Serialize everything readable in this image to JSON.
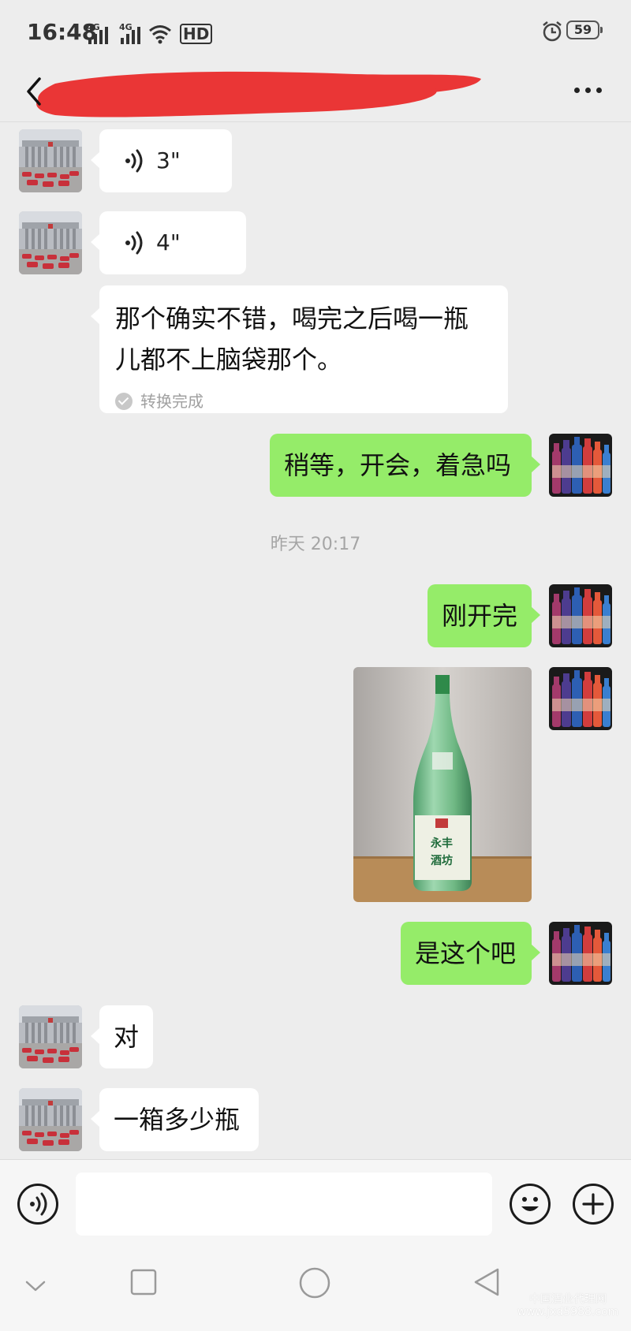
{
  "status_bar": {
    "time": "16:48",
    "network_1": "4G",
    "network_2": "4G",
    "hd_label": "HD",
    "battery_level": "59"
  },
  "header": {
    "back_icon": "chevron-left-icon",
    "title_redacted": true,
    "more_icon": "more-dots-icon"
  },
  "messages": [
    {
      "side": "incoming",
      "type": "voice",
      "duration": "3\""
    },
    {
      "side": "incoming",
      "type": "voice",
      "duration": "4\""
    },
    {
      "side": "incoming",
      "type": "voice-transcript",
      "text_line_1": "那个确实不错，喝完之后喝一瓶",
      "text_line_2": "儿都不上脑袋那个。",
      "status": "转换完成"
    },
    {
      "side": "outgoing",
      "type": "text",
      "text": "稍等，开会，着急吗"
    },
    {
      "type": "timestamp",
      "text": "昨天 20:17"
    },
    {
      "side": "outgoing",
      "type": "text",
      "text": "刚开完"
    },
    {
      "side": "outgoing",
      "type": "image",
      "label_text": "永丰酒坊"
    },
    {
      "side": "outgoing",
      "type": "text",
      "text": "是这个吧"
    },
    {
      "side": "incoming",
      "type": "text",
      "text": "对"
    },
    {
      "side": "incoming",
      "type": "text",
      "text": "一箱多少瓶"
    }
  ],
  "input_bar": {
    "voice_icon": "voice-input-icon",
    "text_value": "",
    "emoji_icon": "emoji-icon",
    "plus_icon": "plus-icon"
  },
  "nav_bar": {
    "icons": [
      "collapse-chevron-icon",
      "recent-apps-icon",
      "home-icon",
      "back-triangle-icon"
    ]
  },
  "watermark": {
    "line_1": "中国酒业代理网",
    "line_2": "www.jxd5988.com"
  },
  "colors": {
    "background": "#ededed",
    "outgoing_bubble": "#95ec69",
    "incoming_bubble": "#ffffff",
    "redaction": "#ea3636"
  }
}
